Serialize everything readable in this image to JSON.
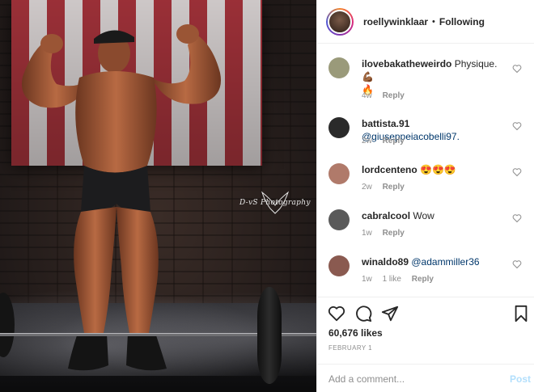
{
  "photo": {
    "watermark": "D-vS Photography"
  },
  "header": {
    "username": "roellywinklaar",
    "separator": "•",
    "follow_status": "Following"
  },
  "comments": [
    {
      "user": "ilovebakatheweirdo",
      "text": "Physique.💪🏾",
      "text2": "🔥",
      "time": "4w",
      "likes": "",
      "reply": "Reply",
      "avatar_color": "#9a9a7a"
    },
    {
      "user": "battista.91",
      "mention": "@giuseppeiacobelli97...",
      "time": "2w",
      "likes": "",
      "reply": "Reply",
      "avatar_color": "#2a2a2a"
    },
    {
      "user": "lordcenteno",
      "text": "😍😍😍",
      "time": "2w",
      "likes": "",
      "reply": "Reply",
      "avatar_color": "#b07a6a"
    },
    {
      "user": "cabralcool",
      "text": "Wow",
      "time": "1w",
      "likes": "",
      "reply": "Reply",
      "avatar_color": "#5a5a5a"
    },
    {
      "user": "winaldo89",
      "mention": "@adammiller36",
      "time": "1w",
      "likes": "1 like",
      "reply": "Reply",
      "avatar_color": "#8a5a50"
    }
  ],
  "actions": {
    "icons": [
      "heart-icon",
      "comment-icon",
      "share-icon",
      "bookmark-icon"
    ],
    "likes": "60,676 likes",
    "date": "FEBRUARY 1"
  },
  "comment_box": {
    "placeholder": "Add a comment...",
    "post_label": "Post"
  }
}
